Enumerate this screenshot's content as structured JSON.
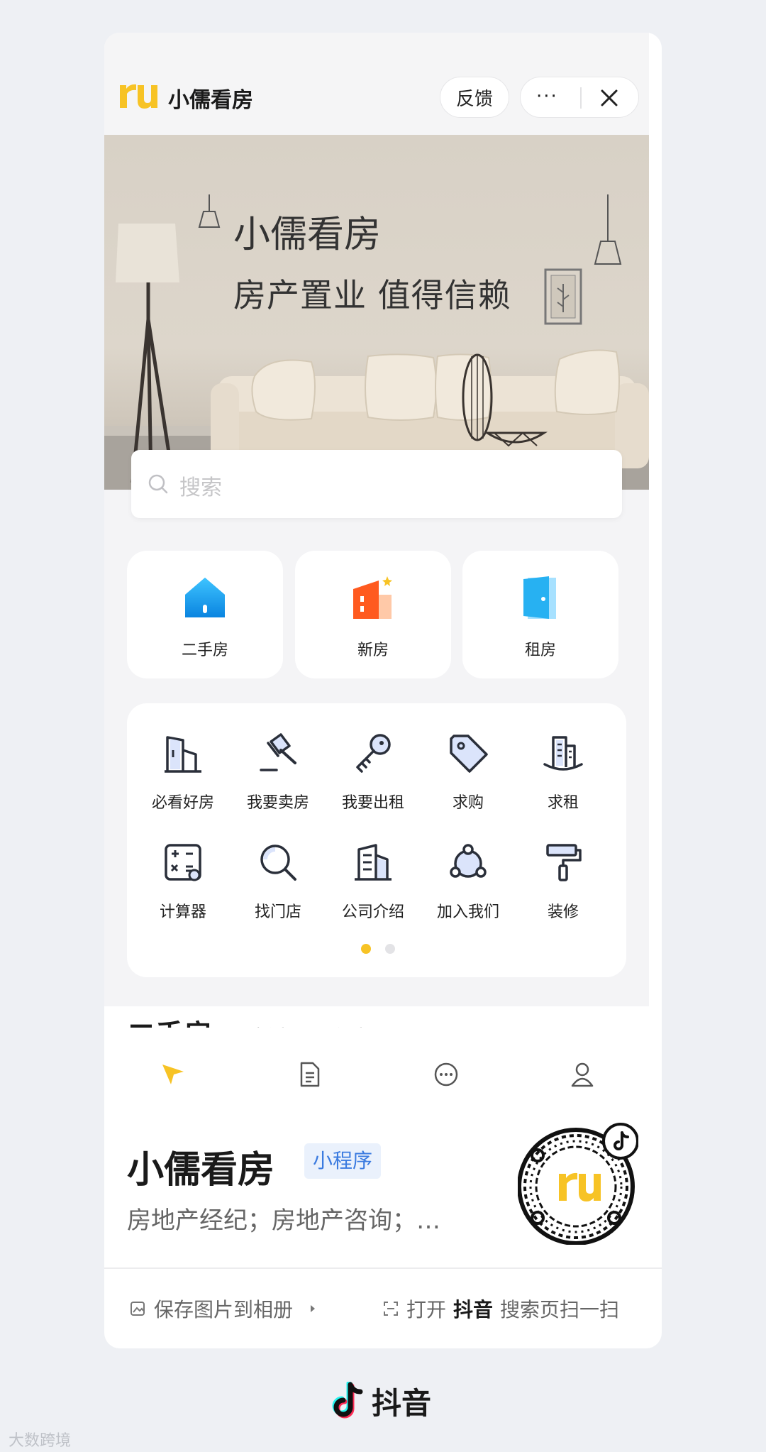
{
  "header": {
    "app_name": "小儒看房",
    "feedback": "反馈",
    "more": "···"
  },
  "banner": {
    "title": "小儒看房",
    "subtitle": "房产置业  值得信赖"
  },
  "search": {
    "placeholder": "搜索"
  },
  "categories": [
    {
      "label": "二手房",
      "icon": "house-icon"
    },
    {
      "label": "新房",
      "icon": "building-icon"
    },
    {
      "label": "租房",
      "icon": "door-icon"
    }
  ],
  "grid": [
    {
      "label": "必看好房",
      "icon": "buildings-icon"
    },
    {
      "label": "我要卖房",
      "icon": "gavel-icon"
    },
    {
      "label": "我要出租",
      "icon": "key-icon"
    },
    {
      "label": "求购",
      "icon": "tag-icon"
    },
    {
      "label": "求租",
      "icon": "tower-icon"
    },
    {
      "label": "计算器",
      "icon": "calculator-icon"
    },
    {
      "label": "找门店",
      "icon": "search-icon"
    },
    {
      "label": "公司介绍",
      "icon": "company-icon"
    },
    {
      "label": "加入我们",
      "icon": "team-icon"
    },
    {
      "label": "装修",
      "icon": "paint-roller-icon"
    }
  ],
  "pagination": {
    "pages": 2,
    "active": 1
  },
  "listing_tabs": [
    {
      "label": "二手房",
      "active": true
    },
    {
      "label": "新房",
      "active": false
    },
    {
      "label": "租房",
      "active": false
    }
  ],
  "bottom_nav": [
    "home-icon",
    "document-icon",
    "message-icon",
    "profile-icon"
  ],
  "miniprogram": {
    "title": "小儒看房",
    "badge": "小程序",
    "description": "房地产经纪；房地产咨询；…"
  },
  "actions": {
    "save": "保存图片到相册",
    "open_prefix": "打开",
    "open_app": "抖音",
    "open_suffix": "搜索页扫一扫"
  },
  "footer": {
    "brand": "抖音"
  },
  "watermark": "大数跨境",
  "colors": {
    "accent": "#f7c325",
    "badge_blue": "#3b7be0",
    "tile_blue": "#1aa3f0",
    "tile_orange": "#ff5a1f"
  }
}
